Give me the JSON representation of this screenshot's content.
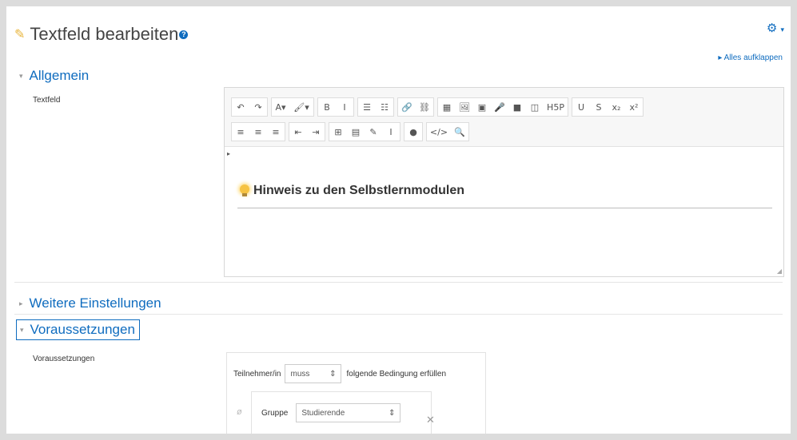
{
  "page": {
    "title": "Textfeld bearbeiten",
    "help_glyph": "?",
    "gear_glyph": "⚙",
    "gear_caret": "▾",
    "expand_all": "Alles aufklappen",
    "expand_arrow": "▸"
  },
  "sections": {
    "general": "Allgemein",
    "more_settings": "Weitere Einstellungen",
    "restrictions": "Voraussetzungen",
    "arrow_open": "▾",
    "arrow_closed": "▸"
  },
  "fields": {
    "textfield_label": "Textfeld",
    "restrictions_label": "Voraussetzungen"
  },
  "editor": {
    "toolbar_row1": [
      [
        "↶",
        "↷"
      ],
      [
        "A▾",
        "🖌▾"
      ],
      [
        "B",
        "I"
      ],
      [
        "☰",
        "☷"
      ],
      [
        "🔗",
        "⛓"
      ],
      [
        "▦",
        "🖼",
        "▣",
        "🎤",
        "■",
        "◫",
        "H5P"
      ],
      [
        "U",
        "S",
        "x₂",
        "x²"
      ]
    ],
    "toolbar_row2": [
      [
        "≡",
        "≡",
        "≡"
      ],
      [
        "⇤",
        "⇥"
      ],
      [
        "⊞",
        "▤",
        "✎",
        "Ⅰ"
      ],
      [
        "●"
      ],
      [
        "</>",
        "🔍"
      ]
    ],
    "heading": "Hinweis zu den Selbstlernmodulen",
    "caret": "▸",
    "resize_glyph": "◢"
  },
  "restriction": {
    "prefix": "Teilnehmer/in",
    "must_value": "muss",
    "suffix": "folgende Bedingung erfüllen",
    "condition_type": "Gruppe",
    "group_value": "Studierende",
    "select_arrows": "⇕",
    "eye_glyph": "ø",
    "remove_glyph": "✕"
  },
  "colors": {
    "accent": "#0f6cbf",
    "pencil": "#e8b43a"
  }
}
